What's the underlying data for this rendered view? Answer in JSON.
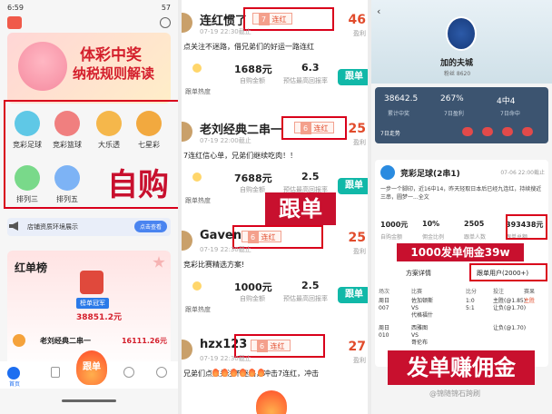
{
  "left": {
    "status": {
      "time": "6:59",
      "battery": "57"
    },
    "banner": {
      "title": "体彩中奖",
      "subtitle": "纳税规则解读"
    },
    "categories": [
      {
        "label": "竞彩足球",
        "color": "#5fc8e6"
      },
      {
        "label": "竞彩篮球",
        "color": "#f07f7f"
      },
      {
        "label": "大乐透",
        "color": "#f5b74b"
      },
      {
        "label": "七星彩",
        "color": "#f2a93f"
      },
      {
        "label": "排列三",
        "color": "#79d98a"
      },
      {
        "label": "排列五",
        "color": "#7db3f5"
      }
    ],
    "annotation": "自购",
    "notice": {
      "text": "店铺资质环境展示",
      "button": "点击查看"
    },
    "leaderboard": {
      "title": "红单榜",
      "badge": "榜单冠军",
      "amount": "38851.2元",
      "row_name": "老刘经典二串一",
      "row_amount": "16111.26元"
    },
    "nav": {
      "items": [
        "首页",
        "",
        "跟单",
        "",
        ""
      ],
      "center": "跟单"
    }
  },
  "middle": {
    "annotation": "跟单",
    "header_left": "彩足球]",
    "posts": [
      {
        "name": "连红惯了",
        "streak": "7",
        "streak_label": "连红",
        "date": "07-19 22:30截止",
        "desc": "点关注不迷路，借兄弟们的好运一路连红",
        "amount": "1688元",
        "amount_label": "自购金额",
        "odds": "6.3",
        "odds_label": "预估最高回报率",
        "follow": "跟单",
        "hot": "跟单热度",
        "count": "46"
      },
      {
        "name": "老刘经典二串一",
        "streak": "6",
        "streak_label": "连红",
        "date": "07-19 22:00截止",
        "desc": "7连红信心单，兄弟们继续吃肉！！",
        "amount": "7688元",
        "amount_label": "自购金额",
        "odds": "2.5",
        "odds_label": "预估最高回报率",
        "follow": "跟单",
        "hot": "跟单热度",
        "count": "25"
      },
      {
        "name": "Gaven",
        "streak": "6",
        "streak_label": "连红",
        "date": "07-19 22:30截止",
        "desc": "竞彩比赛精选方案!",
        "amount": "1000元",
        "amount_label": "自购金额",
        "odds": "2.5",
        "odds_label": "预估最高回报率",
        "follow": "跟单",
        "hot": "跟单热度",
        "count": "25",
        "extra": "盈利"
      },
      {
        "name": "hzx123",
        "streak": "6",
        "streak_label": "连红",
        "date": "07-19 22:30截止",
        "desc": "兄弟们点点关注不迷路，冲击7连红，冲击",
        "count": "27",
        "extra": "盈利"
      }
    ],
    "side_texts": [
      "盈利",
      "盈利",
      "盈利",
      "盈利"
    ]
  },
  "right": {
    "profile": {
      "name": "加的夫城",
      "fans": "粉丝 8620"
    },
    "stats": [
      {
        "v": "38642.5",
        "l": "累计中奖"
      },
      {
        "v": "267%",
        "l": "7日盈利"
      },
      {
        "v": "4中4",
        "l": "7日命中"
      }
    ],
    "streak_label": "7日走势",
    "plan": {
      "title": "竞彩足球(2串1)",
      "date": "07-06 22:00截止",
      "desc": "一步一个脚印，近16中14，昨天轻取日本后已经九连红，持续搜近三串，圆梦一...全文",
      "metrics": [
        {
          "v": "1000元",
          "l": "自购金额"
        },
        {
          "v": "10%",
          "l": "佣金比例"
        },
        {
          "v": "2505",
          "l": "跟单人数"
        },
        {
          "v": "393438元",
          "l": "跟单总额"
        }
      ]
    },
    "commission_banner": "1000发单佣金39w",
    "tabs": [
      "方案详情",
      "跟单用户(2000+)"
    ],
    "table_headers": [
      "场次",
      "比赛",
      "比分",
      "投注",
      "赛果"
    ],
    "table_rows": [
      [
        "周日\n007",
        "佐加顿斯\nVS\n代格福什",
        "1:0\n5:1",
        "主胜(@1.85)\n让负(@1.70)",
        "主胜"
      ],
      [
        "周日\n010",
        "西雅图\nVS\n哥伦布",
        "",
        "让负(@1.70)",
        ""
      ]
    ],
    "annotation": "发单赚佣金",
    "watermark": "@锦随锦石跨刷"
  }
}
